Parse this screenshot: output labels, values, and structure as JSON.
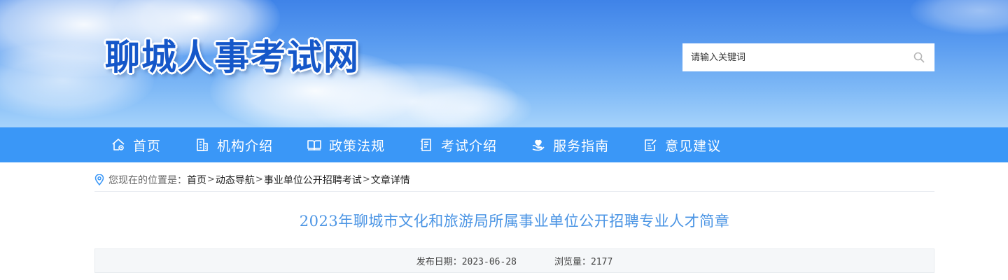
{
  "site": {
    "logo_text": "聊城人事考试网"
  },
  "search": {
    "placeholder": "请输入关键词",
    "icon": "search-icon"
  },
  "nav": {
    "items": [
      {
        "label": "首页",
        "icon": "home-icon"
      },
      {
        "label": "机构介绍",
        "icon": "building-icon"
      },
      {
        "label": "政策法规",
        "icon": "book-icon"
      },
      {
        "label": "考试介绍",
        "icon": "document-icon"
      },
      {
        "label": "服务指南",
        "icon": "heart-hand-icon"
      },
      {
        "label": "意见建议",
        "icon": "edit-note-icon"
      }
    ]
  },
  "breadcrumb": {
    "icon": "location-pin-icon",
    "prefix": "您现在的位置是：",
    "items": [
      "首页",
      "动态导航",
      "事业单位公开招聘考试",
      "文章详情"
    ],
    "separator": ">"
  },
  "article": {
    "title": "2023年聊城市文化和旅游局所属事业单位公开招聘专业人才简章",
    "publish_label": "发布日期：2023-06-28",
    "views_label": "浏览量：2177"
  },
  "colors": {
    "nav_bg": "#3a97f7",
    "title_color": "#4a94e4",
    "logo_color": "#1557c9"
  }
}
